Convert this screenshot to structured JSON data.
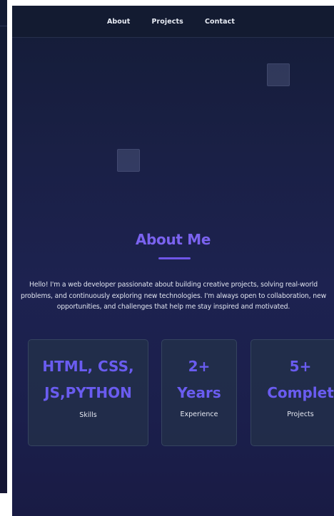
{
  "nav": {
    "items": [
      {
        "label": "About"
      },
      {
        "label": "Projects"
      },
      {
        "label": "Contact"
      }
    ]
  },
  "about": {
    "title": "About Me",
    "text": "Hello! I'm a web developer passionate about building creative projects, solving real-world problems, and continuously exploring new technologies. I'm always open to collaboration, new opportunities, and challenges that help me stay inspired and motivated."
  },
  "stats": [
    {
      "value_line1": "HTML, CSS,",
      "value_line2": "JS,PYTHON",
      "label": "Skills"
    },
    {
      "value_line1": "2+",
      "value_line2": "Years",
      "label": "Experience"
    },
    {
      "value_line1": "5+",
      "value_line2": "Complet",
      "label": "Projects"
    }
  ],
  "colors": {
    "accent": "#6a5cf0",
    "background": "#1b2048",
    "navbar": "#131b31",
    "card": "#24324a"
  }
}
